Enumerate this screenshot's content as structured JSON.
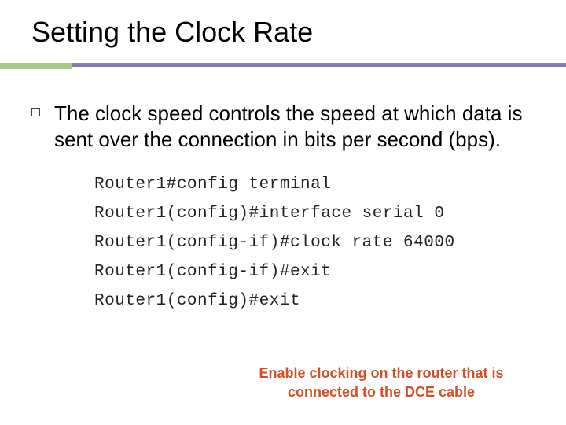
{
  "title": "Setting the Clock Rate",
  "body": "The clock speed controls the speed at which data is sent over the connection in bits per second (bps).",
  "code": {
    "line1": "Router1#config terminal",
    "line2": "Router1(config)#interface serial 0",
    "line3": "Router1(config-if)#clock rate 64000",
    "line4": "Router1(config-if)#exit",
    "line5": "Router1(config)#exit"
  },
  "caption": "Enable clocking on the router that is connected to the DCE cable"
}
